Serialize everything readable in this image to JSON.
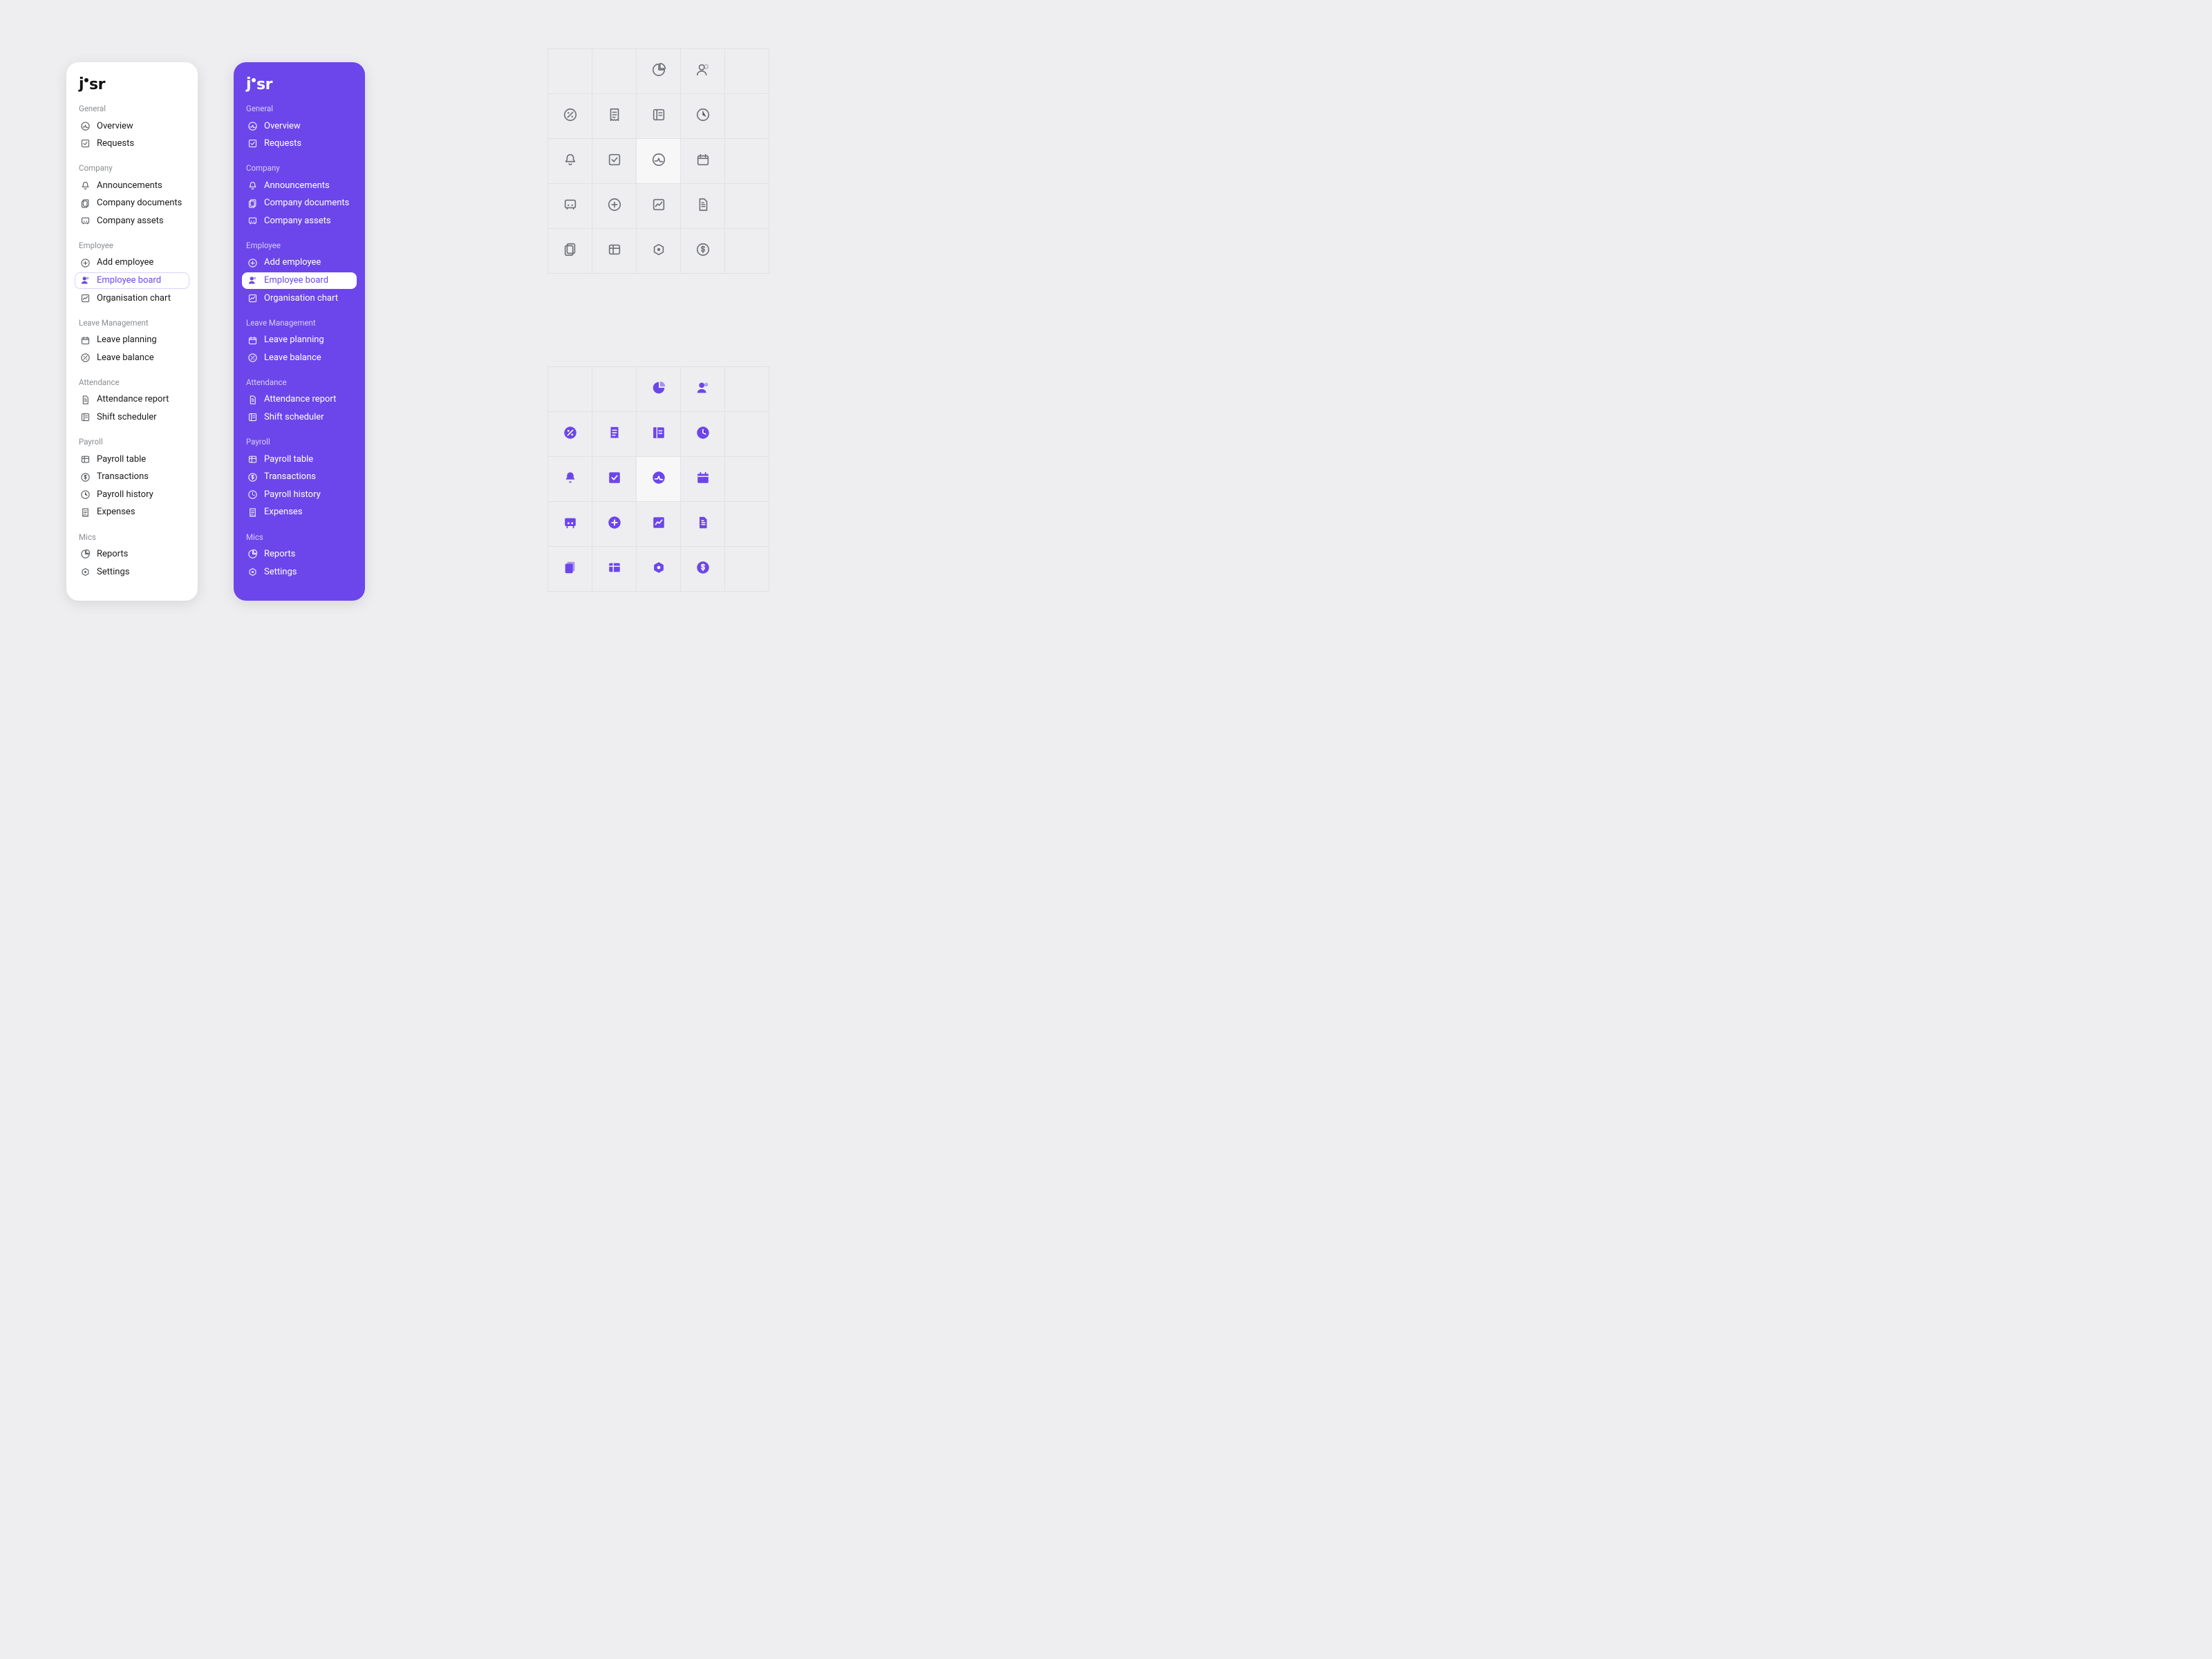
{
  "brand": "jisr",
  "sections": [
    {
      "title": "General",
      "items": [
        {
          "icon": "overview",
          "label": "Overview"
        },
        {
          "icon": "requests",
          "label": "Requests"
        }
      ]
    },
    {
      "title": "Company",
      "items": [
        {
          "icon": "bell",
          "label": "Announcements"
        },
        {
          "icon": "docs",
          "label": "Company documents"
        },
        {
          "icon": "assets",
          "label": "Company assets"
        }
      ]
    },
    {
      "title": "Employee",
      "items": [
        {
          "icon": "add",
          "label": "Add employee"
        },
        {
          "icon": "person",
          "label": "Employee board",
          "active": true
        },
        {
          "icon": "chart",
          "label": "Organisation chart"
        }
      ]
    },
    {
      "title": "Leave Management",
      "items": [
        {
          "icon": "calendar",
          "label": "Leave planning"
        },
        {
          "icon": "percent",
          "label": "Leave balance"
        }
      ]
    },
    {
      "title": "Attendance",
      "items": [
        {
          "icon": "file",
          "label": "Attendance report"
        },
        {
          "icon": "schedule",
          "label": "Shift scheduler"
        }
      ]
    },
    {
      "title": "Payroll",
      "items": [
        {
          "icon": "table",
          "label": "Payroll table"
        },
        {
          "icon": "dollar",
          "label": "Transactions"
        },
        {
          "icon": "clock",
          "label": "Payroll history"
        },
        {
          "icon": "receipt",
          "label": "Expenses"
        }
      ]
    },
    {
      "title": "Mics",
      "items": [
        {
          "icon": "pie",
          "label": "Reports"
        },
        {
          "icon": "settings",
          "label": "Settings"
        }
      ]
    }
  ],
  "grid_icons": [
    "",
    "",
    "pie",
    "person",
    "",
    "percent",
    "receipt",
    "schedule",
    "clock",
    "",
    "bell",
    "requests",
    "overview",
    "calendar",
    "",
    "assets",
    "add",
    "chart",
    "file",
    "",
    "docs",
    "table",
    "settings",
    "dollar",
    ""
  ]
}
